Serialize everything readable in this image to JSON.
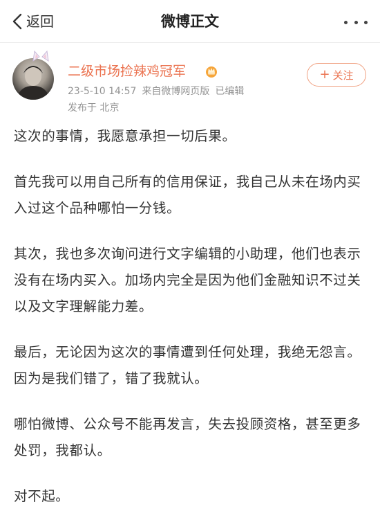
{
  "nav": {
    "back_label": "返回",
    "title": "微博正文"
  },
  "author": {
    "name": "二级市场捡辣鸡冠军",
    "timestamp": "23-5-10 14:57",
    "source": "来自微博网页版",
    "edited": "已编辑",
    "location": "发布于 北京",
    "follow_label": "关注",
    "follow_plus": "+"
  },
  "post": {
    "paragraphs": [
      "这次的事情，我愿意承担一切后果。",
      "首先我可以用自己所有的信用保证，我自己从未在场内买入过这个品种哪怕一分钱。",
      "其次，我也多次询问进行文字编辑的小助理，他们也表示没有在场内买入。加场内完全是因为他们金融知识不过关以及文字理解能力差。",
      "最后，无论因为这次的事情遭到任何处理，我绝无怨言。因为是我们错了，错了我就认。",
      "哪怕微博、公众号不能再发言，失去投顾资格，甚至更多处罚，我都认。",
      "对不起。"
    ]
  },
  "colors": {
    "accent": "#eb7350",
    "meta_text": "#939393",
    "body_text": "#333333"
  },
  "icons": {
    "back": "chevron-left-icon",
    "more": "more-horizontal-icon",
    "vip": "crown-badge-icon",
    "avatar_badge": "animal-ears-badge-icon"
  }
}
